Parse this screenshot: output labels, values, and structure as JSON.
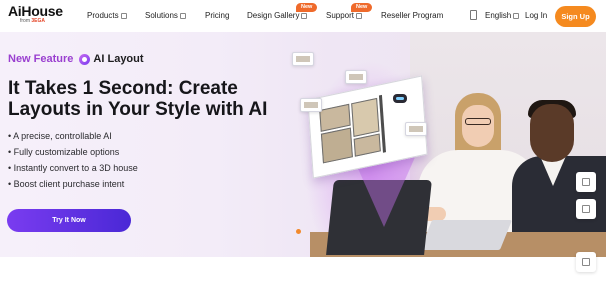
{
  "header": {
    "logo": {
      "name": "AiHouse",
      "sub_prefix": "from",
      "sub_brand": "3EGA"
    },
    "nav": [
      {
        "label": "Products",
        "has_dropdown": true
      },
      {
        "label": "Solutions",
        "has_dropdown": true
      },
      {
        "label": "Pricing",
        "has_dropdown": false
      },
      {
        "label": "Design Gallery",
        "has_dropdown": true,
        "badge": "New"
      },
      {
        "label": "Support",
        "has_dropdown": true,
        "badge": "New"
      },
      {
        "label": "Reseller Program",
        "has_dropdown": false
      }
    ],
    "language": "English",
    "login": "Log In",
    "signup": "Sign Up",
    "accent_color": "#f58a1f"
  },
  "hero": {
    "feature_label": "New Feature",
    "feature_name": "AI Layout",
    "headline": "It Takes 1 Second: Create Layouts in Your Style with AI",
    "bullets": [
      "• A precise, controllable AI",
      "• Fully customizable options",
      "• Instantly convert to a 3D house",
      "• Boost client purchase intent"
    ],
    "cta": "Try It Now",
    "cta_color": "#6a34e8",
    "slide_count_active": 1
  },
  "icons": {
    "cart": "cart-icon",
    "side_tools": [
      "chat-icon",
      "feedback-icon",
      "top-icon"
    ]
  }
}
